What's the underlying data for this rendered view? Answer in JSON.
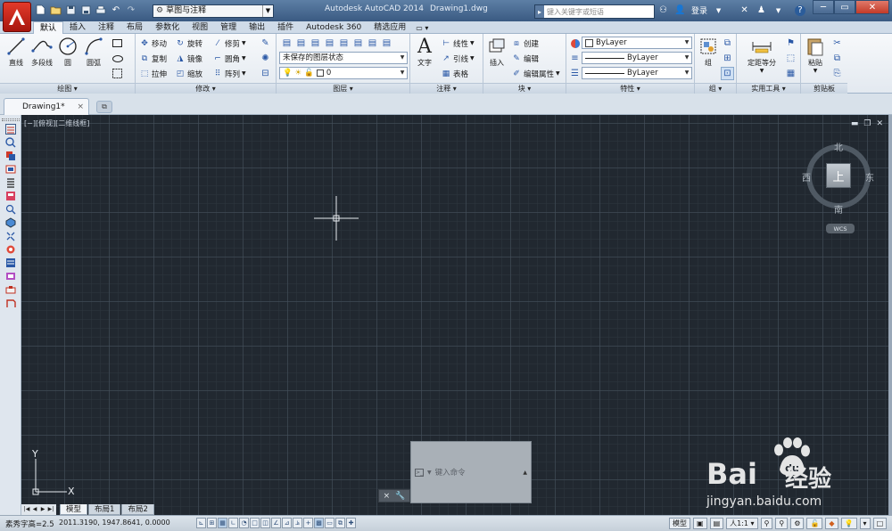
{
  "app": {
    "title": "Autodesk AutoCAD 2014",
    "document": "Drawing1.dwg",
    "workspace": "草图与注释",
    "search_placeholder": "键入关键字或短语",
    "login": "登录",
    "help": "?"
  },
  "ribbon_tabs": [
    "默认",
    "插入",
    "注释",
    "布局",
    "参数化",
    "视图",
    "管理",
    "输出",
    "插件",
    "Autodesk 360",
    "精选应用"
  ],
  "ribbon_tab_extra": "▭ ▾",
  "panels": {
    "draw": {
      "title": "绘图 ▾",
      "line": "直线",
      "polyline": "多段线",
      "circle": "圆",
      "arc": "圆弧"
    },
    "modify": {
      "title": "修改 ▾",
      "move": "移动",
      "rotate": "旋转",
      "trim": "修剪",
      "copy": "复制",
      "mirror": "镜像",
      "fillet": "圆角",
      "stretch": "拉伸",
      "scale": "缩放",
      "array": "阵列"
    },
    "layers": {
      "title": "图层 ▾",
      "state": "未保存的图层状态",
      "current_layer": "0"
    },
    "annotation": {
      "title": "注释 ▾",
      "text": "文字",
      "linear": "线性",
      "leader": "引线",
      "table": "表格"
    },
    "block": {
      "title": "块 ▾",
      "insert": "插入",
      "create": "创建",
      "edit": "编辑",
      "edit_attributes": "编辑属性"
    },
    "properties": {
      "title": "特性 ▾",
      "color": "ByLayer",
      "linetype": "ByLayer",
      "lineweight": "ByLayer"
    },
    "groups": {
      "title": "组 ▾",
      "group": "组"
    },
    "utilities": {
      "title": "实用工具 ▾",
      "measure": "定距等分"
    },
    "clipboard": {
      "title": "剪贴板",
      "paste": "粘贴"
    }
  },
  "doc_tab": {
    "label": "Drawing1*",
    "close": "×"
  },
  "viewport": {
    "label": "[−][俯视][二维线框]",
    "viewcube": {
      "north": "北",
      "south": "南",
      "west": "西",
      "east": "东",
      "face": "上",
      "wcs": "WCS"
    },
    "ucs_x": "X",
    "ucs_y": "Y"
  },
  "command_line": {
    "placeholder": "键入命令",
    "close": "×"
  },
  "layout_tabs": [
    "模型",
    "布局1",
    "布局2"
  ],
  "status": {
    "text_height": "素秀字高=2.5",
    "coordinates": "2011.3190, 1947.8641, 0.0000",
    "model": "模型",
    "scale": "人1:1 ▾"
  },
  "watermark": {
    "brand": "Bai",
    "brand_cn": "经验",
    "url": "jingyan.baidu.com"
  },
  "colors": {
    "canvas": "#212830",
    "title_bar": "#3a5a82",
    "app_button": "#c8261a"
  }
}
